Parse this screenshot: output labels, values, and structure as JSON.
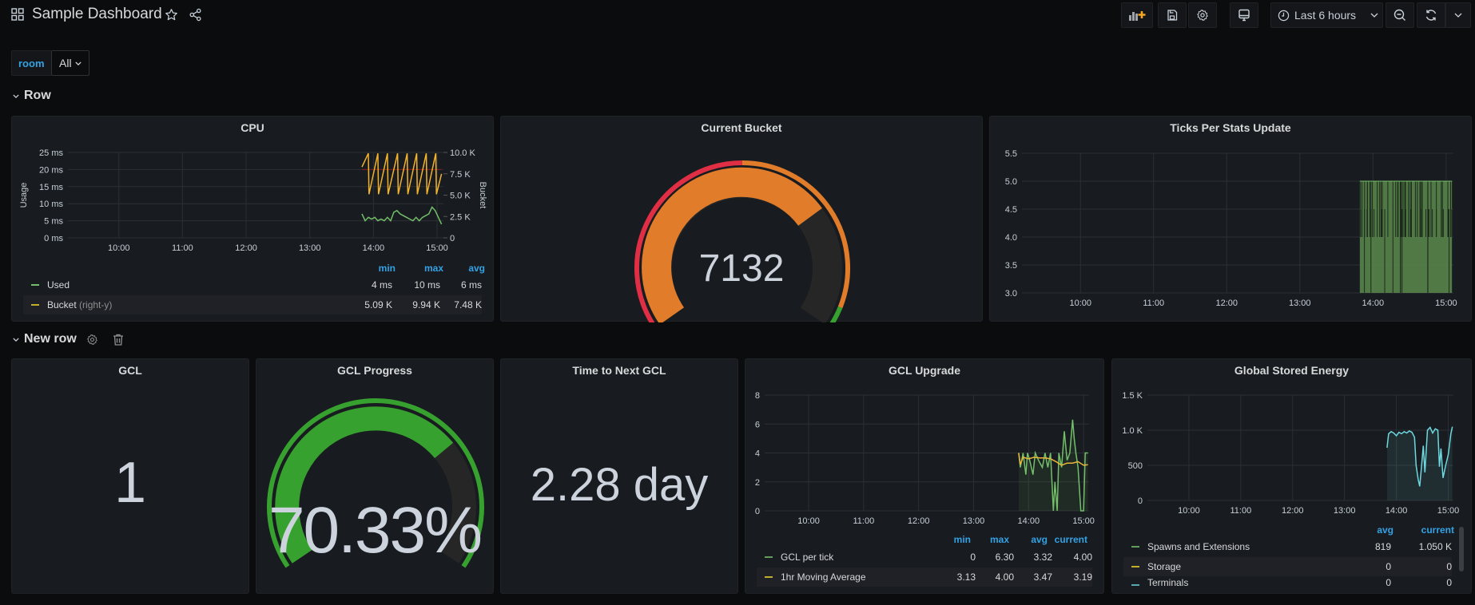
{
  "header": {
    "title": "Sample Dashboard",
    "time_range": "Last 6 hours",
    "icons": [
      "dashboard-grid-icon",
      "star-icon",
      "share-icon",
      "add-panel-icon",
      "save-icon",
      "settings-icon",
      "tv-mode-icon",
      "clock-icon",
      "zoom-out-icon",
      "refresh-icon",
      "chevron-down-icon"
    ]
  },
  "variables": {
    "label": "room",
    "value": "All"
  },
  "rows": [
    {
      "title": "Row"
    },
    {
      "title": "New row"
    }
  ],
  "colors": {
    "green": "#73bf69",
    "yellow": "#fade2a",
    "orange": "#e07c2a",
    "red": "#e02f44",
    "gauge_green": "#37a12f",
    "cyan": "#6dd8e0",
    "legend_header": "#33a2e5"
  },
  "panels": {
    "cpu": {
      "title": "CPU",
      "legend_headers": [
        "min",
        "max",
        "avg"
      ],
      "legend": [
        {
          "name": "Used",
          "suffix": "",
          "min": "4 ms",
          "max": "10 ms",
          "avg": "6 ms"
        },
        {
          "name": "Bucket",
          "suffix": "(right-y)",
          "min": "5.09 K",
          "max": "9.94 K",
          "avg": "7.48 K"
        }
      ]
    },
    "current_bucket": {
      "title": "Current Bucket",
      "value": "7132",
      "min": 0,
      "max": 10000,
      "fraction": 0.7132
    },
    "ticks": {
      "title": "Ticks Per Stats Update"
    },
    "gcl": {
      "title": "GCL",
      "value": "1"
    },
    "gcl_progress": {
      "title": "GCL Progress",
      "value": "70.33%",
      "fraction": 0.7033
    },
    "time_next_gcl": {
      "title": "Time to Next GCL",
      "value": "2.28 day"
    },
    "gcl_upgrade": {
      "title": "GCL Upgrade",
      "legend_headers": [
        "min",
        "max",
        "avg",
        "current"
      ],
      "legend": [
        {
          "name": "GCL per tick",
          "min": "0",
          "max": "6.30",
          "avg": "3.32",
          "current": "4.00"
        },
        {
          "name": "1hr Moving Average",
          "min": "3.13",
          "max": "4.00",
          "avg": "3.47",
          "current": "3.19"
        }
      ]
    },
    "energy": {
      "title": "Global Stored Energy",
      "legend_headers": [
        "avg",
        "current"
      ],
      "legend": [
        {
          "name": "Spawns and Extensions",
          "avg": "819",
          "current": "1.050 K"
        },
        {
          "name": "Storage",
          "avg": "0",
          "current": "0"
        },
        {
          "name": "Terminals",
          "avg": "0",
          "current": "0"
        }
      ]
    }
  },
  "chart_data": [
    {
      "id": "cpu",
      "type": "line",
      "title": "CPU",
      "xlabel": "",
      "ylabel": "Usage",
      "y2label": "Bucket",
      "x_ticks": [
        "10:00",
        "11:00",
        "12:00",
        "13:00",
        "14:00",
        "15:00"
      ],
      "x_range": [
        9.2,
        15.1
      ],
      "y_ticks": [
        "0 ms",
        "5 ms",
        "10 ms",
        "15 ms",
        "20 ms",
        "25 ms"
      ],
      "ylim": [
        0,
        25
      ],
      "y2_ticks": [
        "0",
        "2.5 K",
        "5.0 K",
        "7.5 K",
        "10.0 K"
      ],
      "y2lim": [
        0,
        10000
      ],
      "threshold_y2": 8000,
      "series": [
        {
          "name": "Used",
          "axis": "left",
          "color": "#73bf69",
          "x": [
            13.82,
            13.87,
            13.92,
            13.97,
            14.02,
            14.07,
            14.12,
            14.17,
            14.22,
            14.27,
            14.32,
            14.37,
            14.42,
            14.47,
            14.52,
            14.57,
            14.62,
            14.67,
            14.72,
            14.77,
            14.82,
            14.87,
            14.92,
            14.97,
            15.02,
            15.07
          ],
          "values": [
            7,
            5,
            6,
            5.5,
            6,
            5,
            5.5,
            5,
            6,
            5,
            7.5,
            8,
            7,
            6.5,
            6,
            5.5,
            5,
            6,
            5,
            6,
            6.5,
            7,
            9,
            8,
            6,
            4
          ]
        },
        {
          "name": "Bucket",
          "axis": "right",
          "color": "#fade2a",
          "x": [
            13.82,
            13.92,
            13.93,
            14.07,
            14.08,
            14.22,
            14.23,
            14.38,
            14.39,
            14.53,
            14.54,
            14.68,
            14.69,
            14.83,
            14.84,
            14.98,
            14.99,
            15.07
          ],
          "values": [
            8300,
            9900,
            5100,
            9900,
            5100,
            9900,
            5100,
            9900,
            5100,
            9900,
            5100,
            9900,
            5100,
            9900,
            5100,
            9900,
            5100,
            7500
          ]
        }
      ]
    },
    {
      "id": "ticks",
      "type": "area",
      "title": "Ticks Per Stats Update",
      "x_ticks": [
        "10:00",
        "11:00",
        "12:00",
        "13:00",
        "14:00",
        "15:00"
      ],
      "x_range": [
        9.2,
        15.1
      ],
      "y_ticks": [
        "3.0",
        "3.5",
        "4.0",
        "4.5",
        "5.0",
        "5.5"
      ],
      "ylim": [
        3.0,
        5.5
      ],
      "series": [
        {
          "name": "Ticks",
          "color": "#73bf69",
          "x_start": 13.82,
          "x_end": 15.08,
          "values_min": 4.0,
          "values_max": 5.0
        }
      ]
    },
    {
      "id": "gcl_upgrade",
      "type": "line",
      "title": "GCL Upgrade",
      "x_ticks": [
        "10:00",
        "11:00",
        "12:00",
        "13:00",
        "14:00",
        "15:00"
      ],
      "x_range": [
        9.2,
        15.1
      ],
      "y_ticks": [
        "0",
        "2",
        "4",
        "6",
        "8"
      ],
      "ylim": [
        0,
        8
      ],
      "series": [
        {
          "name": "GCL per tick",
          "color": "#73bf69",
          "x": [
            13.82,
            13.85,
            13.9,
            13.95,
            13.98,
            14.02,
            14.08,
            14.12,
            14.18,
            14.25,
            14.3,
            14.35,
            14.4,
            14.45,
            14.48,
            14.52,
            14.55,
            14.6,
            14.65,
            14.7,
            14.75,
            14.8,
            14.83,
            14.86,
            14.9,
            14.95,
            15.0,
            15.03,
            15.08
          ],
          "values": [
            4,
            3,
            4,
            2.5,
            4,
            3.5,
            2.5,
            4,
            3.5,
            3,
            4,
            3,
            4,
            0,
            2,
            0,
            4,
            3,
            5.5,
            3.5,
            4,
            6.3,
            5,
            4,
            3,
            0,
            0,
            4,
            4
          ]
        },
        {
          "name": "1hr Moving Average",
          "color": "#fade2a",
          "x": [
            13.82,
            13.85,
            13.9,
            14.0,
            14.1,
            14.2,
            14.3,
            14.4,
            14.5,
            14.6,
            14.7,
            14.8,
            14.9,
            15.0,
            15.08
          ],
          "values": [
            4.0,
            3.2,
            3.7,
            3.6,
            3.7,
            3.65,
            3.65,
            3.6,
            3.4,
            3.15,
            3.3,
            3.3,
            3.4,
            3.15,
            3.19
          ]
        }
      ]
    },
    {
      "id": "energy",
      "type": "line",
      "title": "Global Stored Energy",
      "x_ticks": [
        "10:00",
        "11:00",
        "12:00",
        "13:00",
        "14:00",
        "15:00"
      ],
      "x_range": [
        9.2,
        15.1
      ],
      "y_ticks": [
        "0",
        "500",
        "1.0 K",
        "1.5 K"
      ],
      "ylim": [
        0,
        1500
      ],
      "series": [
        {
          "name": "Spawns and Extensions",
          "color": "#6dd8e0",
          "x": [
            13.82,
            13.85,
            13.9,
            13.95,
            14.0,
            14.05,
            14.1,
            14.15,
            14.2,
            14.25,
            14.3,
            14.35,
            14.38,
            14.42,
            14.45,
            14.48,
            14.52,
            14.55,
            14.6,
            14.65,
            14.7,
            14.75,
            14.8,
            14.83,
            14.86,
            14.9,
            14.95,
            15.0,
            15.05,
            15.08
          ],
          "values": [
            750,
            950,
            980,
            960,
            920,
            970,
            950,
            980,
            960,
            990,
            970,
            900,
            500,
            300,
            200,
            450,
            780,
            400,
            1000,
            1040,
            960,
            1020,
            1000,
            480,
            740,
            320,
            500,
            650,
            950,
            1050
          ]
        },
        {
          "name": "Storage",
          "color": "#fade2a",
          "x": [],
          "values": []
        },
        {
          "name": "Terminals",
          "color": "#6dd8e0",
          "x": [],
          "values": []
        }
      ]
    },
    {
      "id": "current_bucket",
      "type": "gauge",
      "title": "Current Bucket",
      "value": 7132,
      "min": 0,
      "max": 10000,
      "thresholds": [
        {
          "from": 0,
          "color": "#e02f44"
        },
        {
          "from": 5000,
          "color": "#e07c2a"
        },
        {
          "from": 9500,
          "color": "#37a12f"
        }
      ]
    },
    {
      "id": "gcl_progress",
      "type": "gauge",
      "title": "GCL Progress",
      "value": 70.33,
      "min": 0,
      "max": 100,
      "thresholds": [
        {
          "from": 0,
          "color": "#37a12f"
        }
      ]
    }
  ]
}
